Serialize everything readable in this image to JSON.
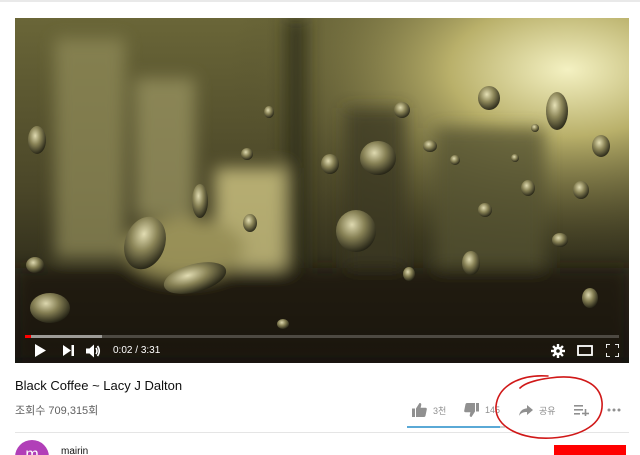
{
  "player": {
    "current_time": "0:02",
    "duration": "3:31",
    "time_separator": " / ",
    "progress_fraction": 0.0095,
    "buffered_fraction": 0.13,
    "accent_color": "#ff0000"
  },
  "video": {
    "title": "Black Coffee ~ Lacy J Dalton",
    "views": "조회수 709,315회"
  },
  "actions": {
    "like_count": "3천",
    "dislike_count": "145",
    "share_label": "공유",
    "like_ratio": 0.95
  },
  "channel": {
    "name": "mairin",
    "avatar_letter": "m",
    "avatar_color": "#b13fb8"
  },
  "annotation": {
    "color": "#d01818"
  }
}
